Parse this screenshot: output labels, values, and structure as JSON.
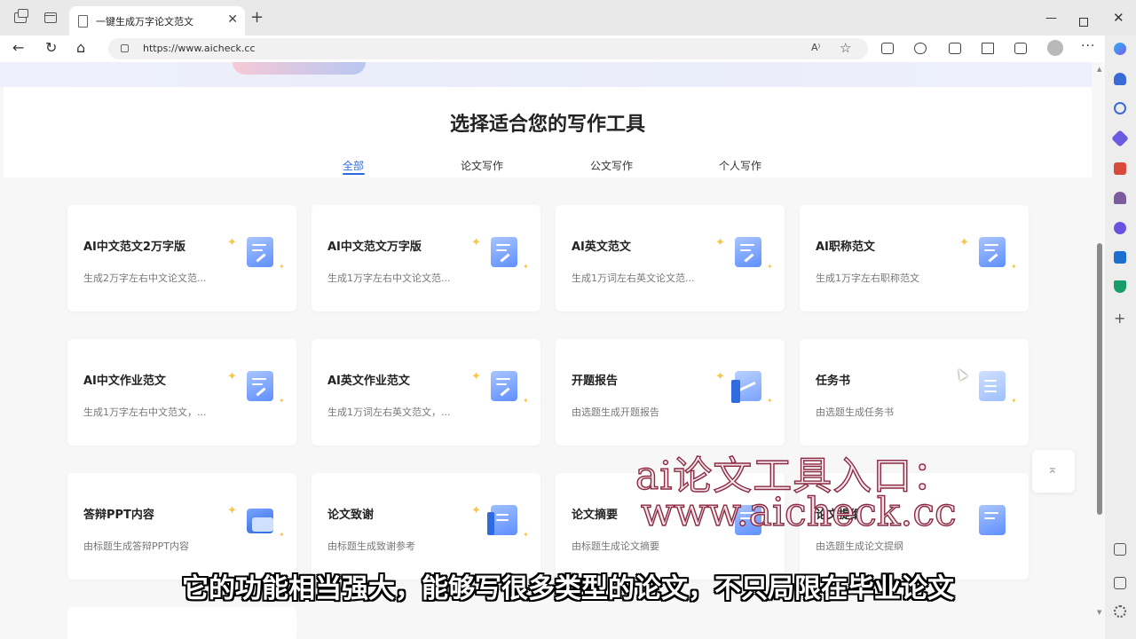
{
  "browser": {
    "tab_title": "一键生成万字论文范文",
    "url": "https://www.aicheck.cc",
    "read_aloud": "A⁾"
  },
  "page": {
    "section_title": "选择适合您的写作工具",
    "categories": [
      "全部",
      "论文写作",
      "公文写作",
      "个人写作"
    ],
    "cards": [
      {
        "title": "AI中文范文2万字版",
        "desc": "生成2万字左右中文论文范..."
      },
      {
        "title": "AI中文范文万字版",
        "desc": "生成1万字左右中文论文范..."
      },
      {
        "title": "AI英文范文",
        "desc": "生成1万词左右英文论文范..."
      },
      {
        "title": "AI职称范文",
        "desc": "生成1万字左右职称范文"
      },
      {
        "title": "AI中文作业范文",
        "desc": "生成1万字左右中文范文，..."
      },
      {
        "title": "AI英文作业范文",
        "desc": "生成1万词左右英文范文，..."
      },
      {
        "title": "开题报告",
        "desc": "由选题生成开题报告"
      },
      {
        "title": "任务书",
        "desc": "由选题生成任务书"
      },
      {
        "title": "答辩PPT内容",
        "desc": "由标题生成答辩PPT内容"
      },
      {
        "title": "论文致谢",
        "desc": "由标题生成致谢参考"
      },
      {
        "title": "论文摘要",
        "desc": "由标题生成论文摘要"
      },
      {
        "title": "论文提纲",
        "desc": "由选题生成论文提纲"
      }
    ]
  },
  "overlay": {
    "line1": "ai论文工具入口：",
    "line2": "www.aicheck.cc",
    "subtitle": "它的功能相当强大，能够写很多类型的论文，不只局限在毕业论文"
  },
  "colors": {
    "accent": "#2f6bdf",
    "overlay_stroke": "#8c2a44",
    "icon_blue": "#5f8fff",
    "spark": "#f7c64b"
  }
}
